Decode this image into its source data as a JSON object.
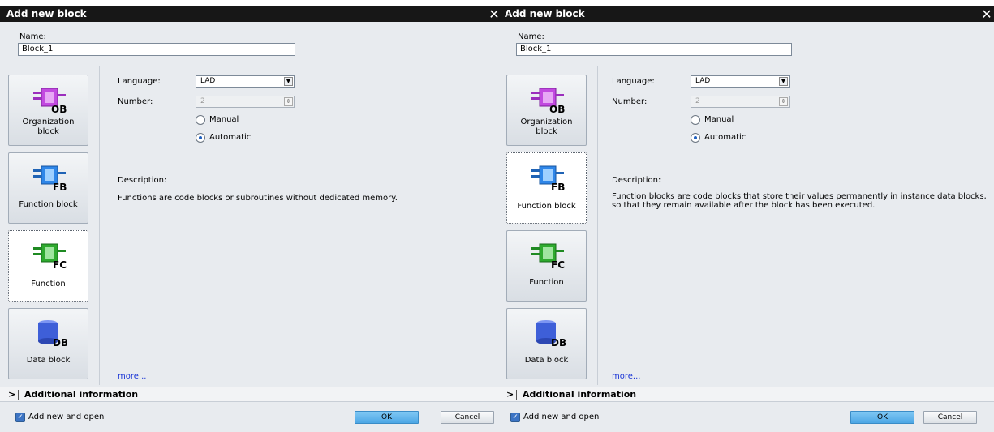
{
  "dialogs": [
    {
      "title": "Add new block",
      "close_glyph": "✕",
      "name_label": "Name:",
      "name_value": "Block_1",
      "blocks": [
        {
          "label": "Organization\nblock",
          "icon": "ob-icon",
          "tag": "OB"
        },
        {
          "label": "Function block",
          "icon": "fb-icon",
          "tag": "FB"
        },
        {
          "label": "Function",
          "icon": "fc-icon",
          "tag": "FC"
        },
        {
          "label": "Data block",
          "icon": "db-icon",
          "tag": "DB"
        }
      ],
      "selected_block": "Function",
      "language_label": "Language:",
      "language_value": "LAD",
      "number_label": "Number:",
      "number_value": "2",
      "manual_label": "Manual",
      "automatic_label": "Automatic",
      "radio_selected": "Automatic",
      "description_label": "Description:",
      "description_text": "Functions are code blocks or subroutines without dedicated memory.",
      "more_label": "more...",
      "additional_info_label": "Additional  information",
      "add_new_open_label": "Add new and open",
      "ok_label": "OK",
      "cancel_label": "Cancel"
    },
    {
      "title": "Add new block",
      "close_glyph": "✕",
      "name_label": "Name:",
      "name_value": "Block_1",
      "blocks": [
        {
          "label": "Organization\nblock",
          "icon": "ob-icon",
          "tag": "OB"
        },
        {
          "label": "Function block",
          "icon": "fb-icon",
          "tag": "FB"
        },
        {
          "label": "Function",
          "icon": "fc-icon",
          "tag": "FC"
        },
        {
          "label": "Data block",
          "icon": "db-icon",
          "tag": "DB"
        }
      ],
      "selected_block": "Function block",
      "language_label": "Language:",
      "language_value": "LAD",
      "number_label": "Number:",
      "number_value": "2",
      "manual_label": "Manual",
      "automatic_label": "Automatic",
      "radio_selected": "Automatic",
      "description_label": "Description:",
      "description_text_line1": "Function blocks are code blocks that store their values permanently in instance data blocks,",
      "description_text_line2": "so that they remain available after the block has been executed.",
      "more_label": "more...",
      "additional_info_label": "Additional  information",
      "add_new_open_label": "Add new and open",
      "ok_label": "OK",
      "cancel_label": "Cancel"
    }
  ],
  "colors": {
    "title_bar": "#171717",
    "dialog_bg": "#e8ebef",
    "ok_button": "#5eb3ea",
    "ob_icon": "#b33ad9",
    "fb_icon": "#2b7fe0",
    "fc_icon": "#2aa52a",
    "db_icon": "#3e5fd8",
    "link": "#1a35d6"
  }
}
